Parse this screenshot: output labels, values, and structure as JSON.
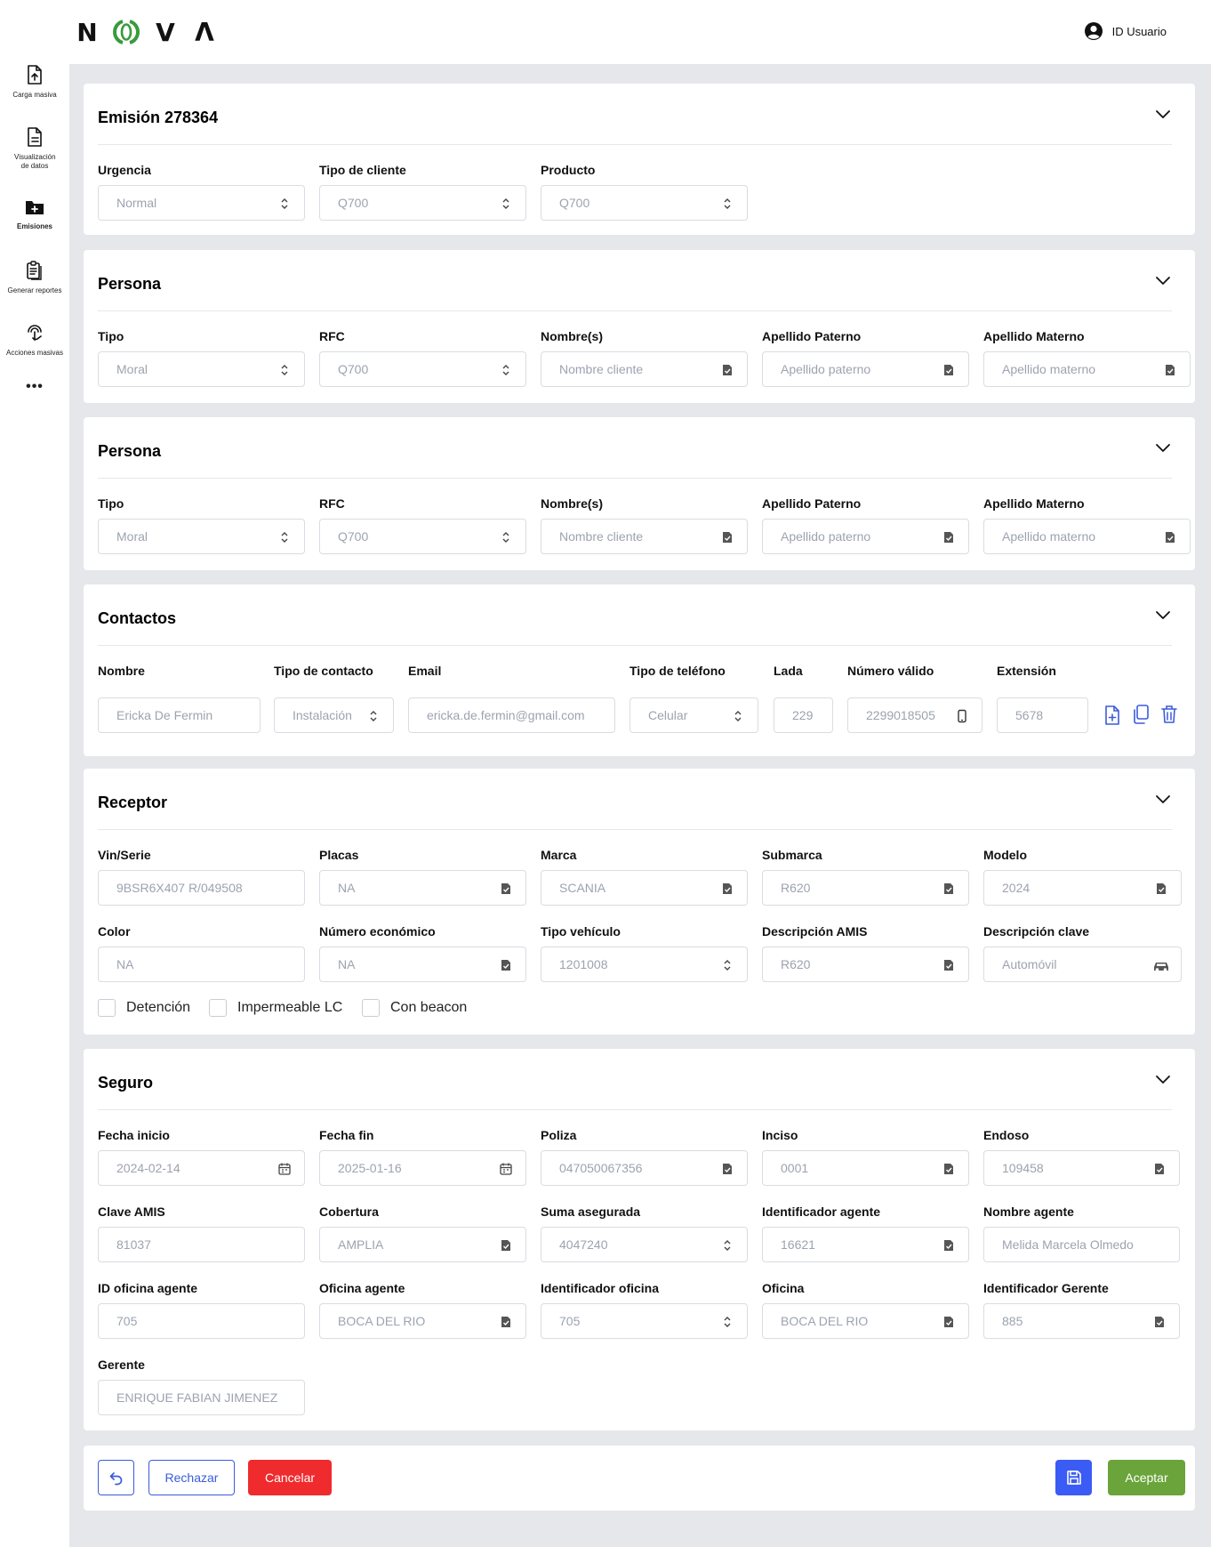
{
  "brand": {
    "letters": [
      "N",
      "V",
      "Λ"
    ]
  },
  "user": {
    "label": "ID Usuario"
  },
  "sidebar": {
    "items": [
      {
        "label": "Carga masiva",
        "icon": "file-upload-icon"
      },
      {
        "label": "Visualización de datos",
        "icon": "document-icon"
      },
      {
        "label": "Emisiones",
        "icon": "folder-plus-icon",
        "active": true
      },
      {
        "label": "Generar reportes",
        "icon": "clipboard-icon"
      },
      {
        "label": "Acciones masivas",
        "icon": "touch-icon"
      }
    ],
    "more": "•••"
  },
  "emision": {
    "title": "Emisión 278364",
    "fields": [
      {
        "label": "Urgencia",
        "value": "Normal"
      },
      {
        "label": "Tipo de cliente",
        "value": "Q700"
      },
      {
        "label": "Producto",
        "value": "Q700"
      }
    ]
  },
  "persona1": {
    "title": "Persona",
    "fields": [
      {
        "label": "Tipo",
        "value": "Moral"
      },
      {
        "label": "RFC",
        "value": "Q700"
      },
      {
        "label": "Nombre(s)",
        "value": "Nombre cliente"
      },
      {
        "label": "Apellido Paterno",
        "value": "Apellido paterno"
      },
      {
        "label": "Apellido Materno",
        "value": "Apellido materno"
      }
    ]
  },
  "persona2": {
    "title": "Persona",
    "fields": [
      {
        "label": "Tipo",
        "value": "Moral"
      },
      {
        "label": "RFC",
        "value": "Q700"
      },
      {
        "label": "Nombre(s)",
        "value": "Nombre cliente"
      },
      {
        "label": "Apellido Paterno",
        "value": "Apellido paterno"
      },
      {
        "label": "Apellido Materno",
        "value": "Apellido materno"
      }
    ]
  },
  "contactos": {
    "title": "Contactos",
    "fields": [
      {
        "label": "Nombre",
        "value": "Ericka De Fermin"
      },
      {
        "label": "Tipo de contacto",
        "value": "Instalación"
      },
      {
        "label": "Email",
        "value": "ericka.de.fermin@gmail.com"
      },
      {
        "label": "Tipo de teléfono",
        "value": "Celular"
      },
      {
        "label": "Lada",
        "value": "229"
      },
      {
        "label": "Número válido",
        "value": "2299018505"
      },
      {
        "label": "Extensión",
        "value": "5678"
      }
    ]
  },
  "receptor": {
    "title": "Receptor",
    "fields": [
      {
        "label": "Vin/Serie",
        "value": "9BSR6X407 R/049508"
      },
      {
        "label": "Placas",
        "value": "NA"
      },
      {
        "label": "Marca",
        "value": "SCANIA"
      },
      {
        "label": "Submarca",
        "value": "R620"
      },
      {
        "label": "Modelo",
        "value": "2024"
      },
      {
        "label": "Color",
        "value": "NA"
      },
      {
        "label": "Número económico",
        "value": "NA"
      },
      {
        "label": "Tipo vehículo",
        "value": "1201008"
      },
      {
        "label": "Descripción AMIS",
        "value": "R620"
      },
      {
        "label": "Descripción clave",
        "value": "Automóvil"
      }
    ],
    "checks": [
      "Detención",
      "Impermeable LC",
      "Con beacon"
    ]
  },
  "seguro": {
    "title": "Seguro",
    "fields": [
      {
        "label": "Fecha inicio",
        "value": "2024-02-14"
      },
      {
        "label": "Fecha fin",
        "value": "2025-01-16"
      },
      {
        "label": "Poliza",
        "value": "047050067356"
      },
      {
        "label": "Inciso",
        "value": "0001"
      },
      {
        "label": "Endoso",
        "value": "109458"
      },
      {
        "label": "Clave AMIS",
        "value": "81037"
      },
      {
        "label": "Cobertura",
        "value": "AMPLIA"
      },
      {
        "label": "Suma asegurada",
        "value": "4047240"
      },
      {
        "label": "Identificador agente",
        "value": "16621"
      },
      {
        "label": "Nombre agente",
        "value": "Melida Marcela Olmedo"
      },
      {
        "label": "ID oficina agente",
        "value": "705"
      },
      {
        "label": "Oficina agente",
        "value": "BOCA DEL RIO"
      },
      {
        "label": "Identificador oficina",
        "value": "705"
      },
      {
        "label": "Oficina",
        "value": "BOCA DEL RIO"
      },
      {
        "label": "Identificador Gerente",
        "value": "885"
      },
      {
        "label": "Gerente",
        "value": "ENRIQUE FABIAN JIMENEZ"
      }
    ]
  },
  "actions": {
    "reject": "Rechazar",
    "cancel": "Cancelar",
    "accept": "Aceptar"
  },
  "colors": {
    "accent_blue": "#3b5bf5",
    "danger_red": "#ef2b2d",
    "success_green": "#6aa43a",
    "logo_green": "#3a9a3e",
    "page_bg": "#e5e7eb"
  }
}
